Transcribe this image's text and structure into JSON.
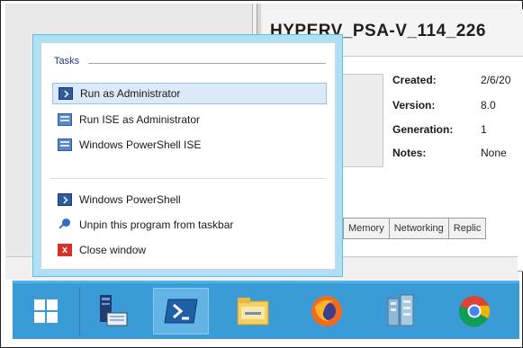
{
  "vm": {
    "name": "HYPERV_PSA-V_114_226",
    "properties": [
      {
        "label": "Created:",
        "value": "2/6/20"
      },
      {
        "label": "Version:",
        "value": "8.0"
      },
      {
        "label": "Generation:",
        "value": "1"
      },
      {
        "label": "Notes:",
        "value": "None"
      }
    ],
    "tabs": [
      "Memory",
      "Networking",
      "Replic"
    ]
  },
  "jumplist": {
    "section_header": "Tasks",
    "tasks": [
      {
        "label": "Run as Administrator",
        "icon": "powershell-icon",
        "selected": true
      },
      {
        "label": "Run ISE as Administrator",
        "icon": "powershell-ise-icon"
      },
      {
        "label": "Windows PowerShell ISE",
        "icon": "powershell-ise-icon"
      }
    ],
    "actions": [
      {
        "label": "Windows PowerShell",
        "icon": "powershell-icon"
      },
      {
        "label": "Unpin this program from taskbar",
        "icon": "unpin-icon"
      },
      {
        "label": "Close window",
        "icon": "close-icon"
      }
    ]
  },
  "taskbar": {
    "items": [
      {
        "icon": "windows-start-icon",
        "active": false
      },
      {
        "icon": "server-manager-icon",
        "active": false
      },
      {
        "icon": "powershell-icon",
        "active": true
      },
      {
        "icon": "file-explorer-icon",
        "active": false
      },
      {
        "icon": "firefox-icon",
        "active": false
      },
      {
        "icon": "hyperv-manager-icon",
        "active": false
      },
      {
        "icon": "chrome-icon",
        "active": false
      }
    ]
  },
  "colors": {
    "taskbar": "#3a9bd6",
    "jumplist_border": "#aedff3",
    "selection": "#dce9f8",
    "header_text": "#1c3e84"
  }
}
